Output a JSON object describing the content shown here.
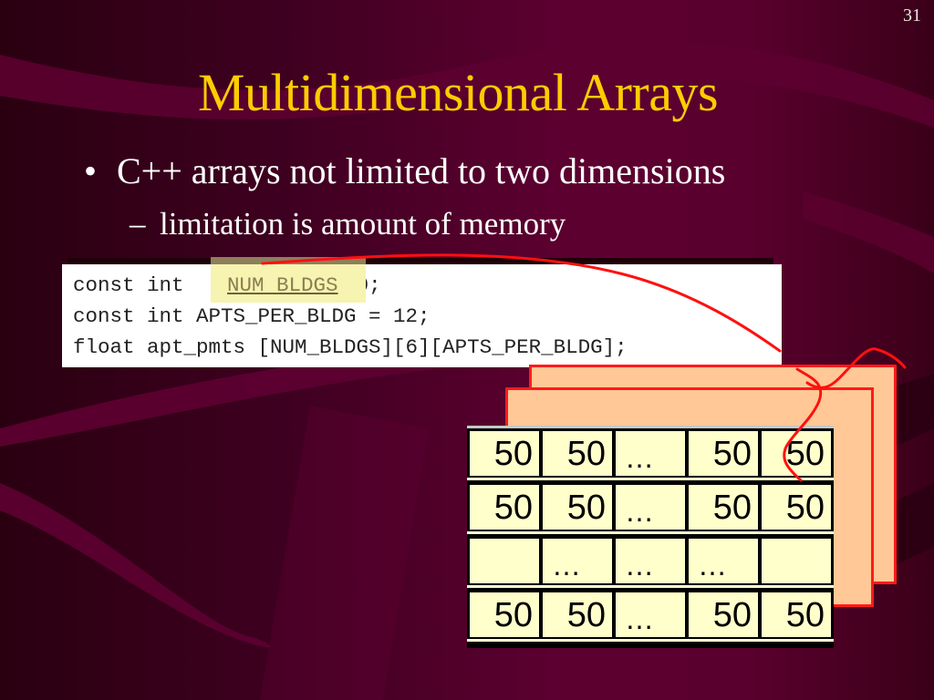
{
  "slide": {
    "page_number": "31",
    "title": "Multidimensional Arrays",
    "bullet": {
      "marker": "•",
      "text": "C++ arrays not limited to two dimensions"
    },
    "sub_bullet": {
      "marker": "–",
      "text": "limitation is amount of memory"
    }
  },
  "code": {
    "lines": [
      {
        "prefix": "const int ",
        "highlight": "NUM BLDGS",
        "suffix": " = 10;"
      },
      {
        "text": "const int APTS_PER_BLDG = 12;"
      },
      {
        "text": "float apt_pmts [NUM_BLDGS][6][APTS_PER_BLDG];"
      }
    ],
    "highlight_label": "NUM BLDGS"
  },
  "diagram": {
    "planes": [
      "back-plane",
      "front-plane"
    ],
    "grid_rows": [
      [
        "50",
        "50",
        "…",
        "50",
        "50"
      ],
      [
        "50",
        "50",
        "…",
        "50",
        "50"
      ],
      [
        "",
        "…",
        "…",
        "…",
        ""
      ],
      [
        "50",
        "50",
        "…",
        "50",
        "50"
      ]
    ]
  },
  "colors": {
    "title": "#ffcc00",
    "text": "#ffffff",
    "plane_fill": "#ffc896",
    "plane_border": "#ff1a1a",
    "cell_fill": "#ffffcc",
    "annotation": "#ff1010",
    "highlight": "#f7f3b0"
  }
}
